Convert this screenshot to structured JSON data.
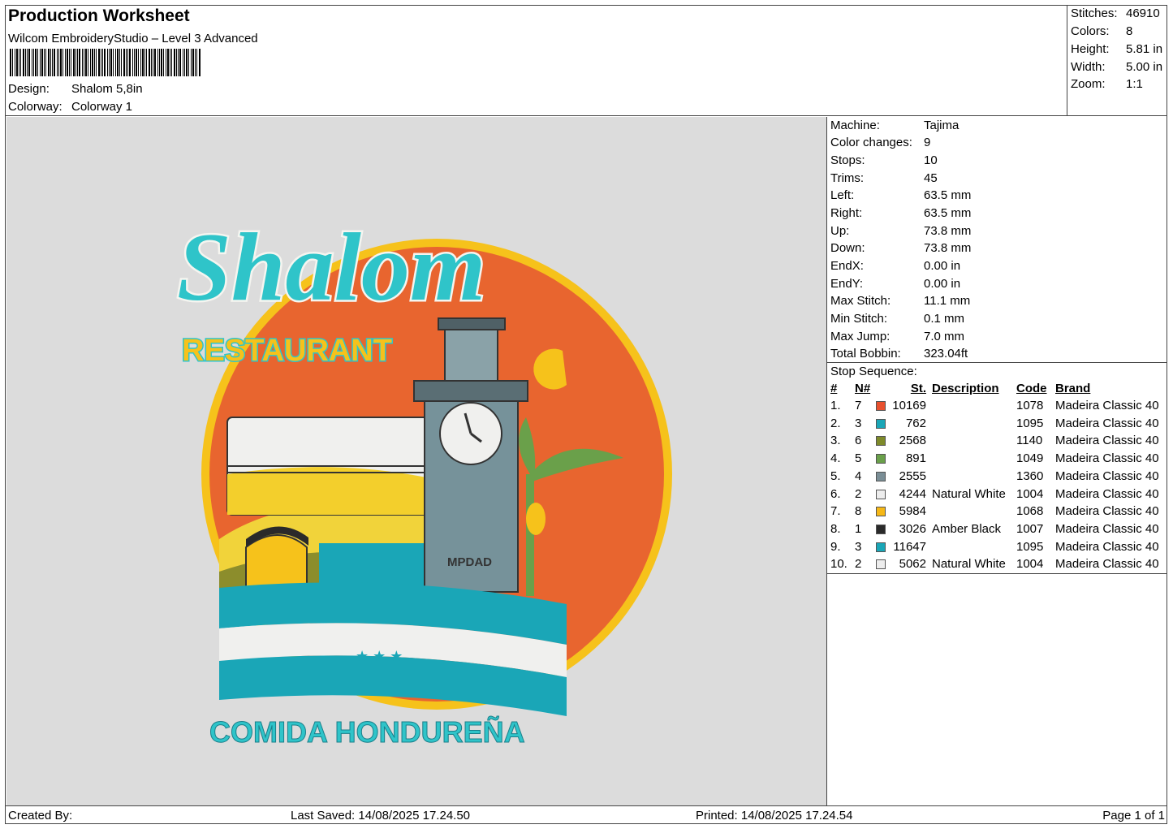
{
  "header": {
    "title": "Production Worksheet",
    "software": "Wilcom EmbroideryStudio – Level 3 Advanced",
    "design_label": "Design:",
    "design_value": "Shalom 5,8in",
    "colorway_label": "Colorway:",
    "colorway_value": "Colorway 1"
  },
  "summary": [
    {
      "label": "Stitches:",
      "value": "46910"
    },
    {
      "label": "Colors:",
      "value": "8"
    },
    {
      "label": "Height:",
      "value": "5.81 in"
    },
    {
      "label": "Width:",
      "value": "5.00 in"
    },
    {
      "label": "Zoom:",
      "value": "1:1"
    }
  ],
  "machine_info": [
    {
      "label": "Machine:",
      "value": "Tajima"
    },
    {
      "label": "Color changes:",
      "value": "9"
    },
    {
      "label": "Stops:",
      "value": "10"
    },
    {
      "label": "Trims:",
      "value": "45"
    },
    {
      "label": "Left:",
      "value": "63.5 mm"
    },
    {
      "label": "Right:",
      "value": "63.5 mm"
    },
    {
      "label": "Up:",
      "value": "73.8 mm"
    },
    {
      "label": "Down:",
      "value": "73.8 mm"
    },
    {
      "label": "EndX:",
      "value": "0.00 in"
    },
    {
      "label": "EndY:",
      "value": "0.00 in"
    },
    {
      "label": "Max Stitch:",
      "value": "11.1 mm"
    },
    {
      "label": "Min Stitch:",
      "value": "0.1 mm"
    },
    {
      "label": "Max Jump:",
      "value": "7.0 mm"
    },
    {
      "label": "Total Bobbin:",
      "value": "323.04ft"
    }
  ],
  "stop_sequence": {
    "title": "Stop Sequence:",
    "headers": {
      "num": "#",
      "n": "N#",
      "st": "St.",
      "desc": "Description",
      "code": "Code",
      "brand": "Brand"
    },
    "rows": [
      {
        "num": "1.",
        "n": "7",
        "color": "#e8502e",
        "st": "10169",
        "desc": "",
        "code": "1078",
        "brand": "Madeira Classic 40"
      },
      {
        "num": "2.",
        "n": "3",
        "color": "#1aa6b7",
        "st": "762",
        "desc": "",
        "code": "1095",
        "brand": "Madeira Classic 40"
      },
      {
        "num": "3.",
        "n": "6",
        "color": "#7e8a2a",
        "st": "2568",
        "desc": "",
        "code": "1140",
        "brand": "Madeira Classic 40"
      },
      {
        "num": "4.",
        "n": "5",
        "color": "#6aa04a",
        "st": "891",
        "desc": "",
        "code": "1049",
        "brand": "Madeira Classic 40"
      },
      {
        "num": "5.",
        "n": "4",
        "color": "#7a8e96",
        "st": "2555",
        "desc": "",
        "code": "1360",
        "brand": "Madeira Classic 40"
      },
      {
        "num": "6.",
        "n": "2",
        "color": "#ededed",
        "st": "4244",
        "desc": "Natural White",
        "code": "1004",
        "brand": "Madeira Classic 40"
      },
      {
        "num": "7.",
        "n": "8",
        "color": "#f6b817",
        "st": "5984",
        "desc": "",
        "code": "1068",
        "brand": "Madeira Classic 40"
      },
      {
        "num": "8.",
        "n": "1",
        "color": "#2a2a2a",
        "st": "3026",
        "desc": "Amber Black",
        "code": "1007",
        "brand": "Madeira Classic 40"
      },
      {
        "num": "9.",
        "n": "3",
        "color": "#1aa6b7",
        "st": "11647",
        "desc": "",
        "code": "1095",
        "brand": "Madeira Classic 40"
      },
      {
        "num": "10.",
        "n": "2",
        "color": "#ededed",
        "st": "5062",
        "desc": "Natural White",
        "code": "1004",
        "brand": "Madeira Classic 40"
      }
    ]
  },
  "design_art": {
    "title": "Shalom",
    "subtitle": "RESTAURANT",
    "tagline": "COMIDA HONDUREÑA",
    "tower_text": "MPDAD"
  },
  "footer": {
    "created_by": "Created By:",
    "last_saved": "Last Saved: 14/08/2025 17.24.50",
    "printed": "Printed: 14/08/2025 17.24.54",
    "page": "Page 1 of 1"
  }
}
